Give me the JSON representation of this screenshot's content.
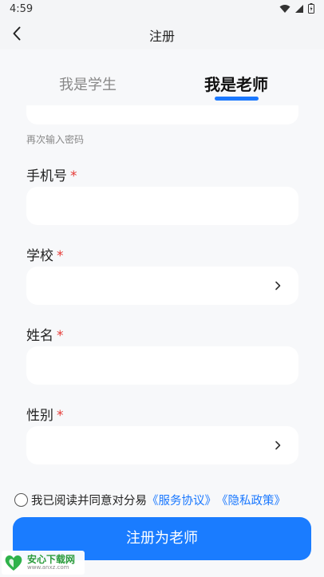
{
  "status_bar": {
    "time": "4:59"
  },
  "header": {
    "title": "注册"
  },
  "tabs": [
    {
      "label": "我是学生",
      "active": false
    },
    {
      "label": "我是老师",
      "active": true
    }
  ],
  "form": {
    "password_confirm_hint": "再次输入密码",
    "fields": [
      {
        "label": "手机号",
        "required_mark": "*",
        "value": "",
        "has_chevron": false
      },
      {
        "label": "学校",
        "required_mark": "*",
        "value": "",
        "has_chevron": true
      },
      {
        "label": "姓名",
        "required_mark": "*",
        "value": "",
        "has_chevron": false
      },
      {
        "label": "性别",
        "required_mark": "*",
        "value": "",
        "has_chevron": true
      }
    ]
  },
  "agreement": {
    "checked": false,
    "text": "我已阅读并同意对分易",
    "service_link": "《服务协议》",
    "privacy_link": "《隐私政策》"
  },
  "submit_label": "注册为老师",
  "watermark": {
    "title": "安心下载网",
    "url": "www.anxz.com"
  },
  "colors": {
    "accent": "#1a7cff",
    "required": "#e53935",
    "background": "#f7f8fa"
  }
}
